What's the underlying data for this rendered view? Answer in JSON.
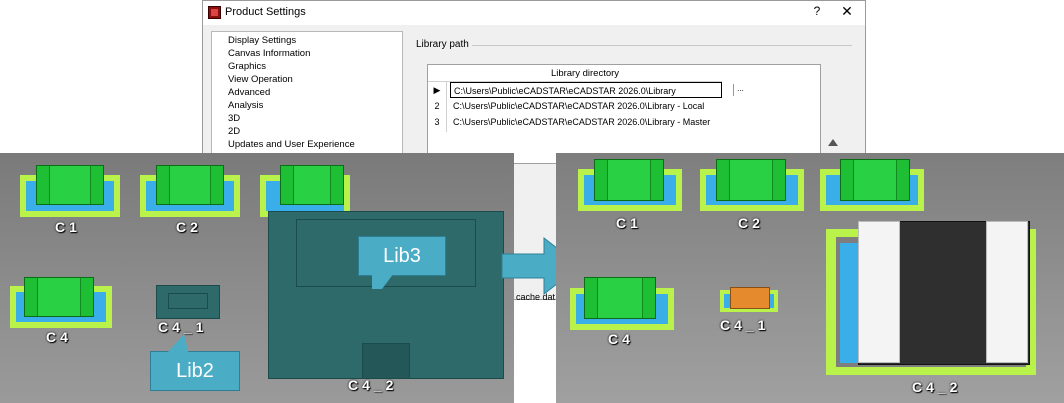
{
  "dialog": {
    "title": "Product Settings",
    "help_label": "?",
    "close_label": "✕",
    "tree": [
      "Display Settings",
      "Canvas Information",
      "Graphics",
      "View Operation",
      "Advanced",
      "Analysis",
      "3D",
      "2D",
      "Updates and User Experience"
    ],
    "group_label": "Library path",
    "grid_header": "Library directory",
    "rows": [
      {
        "num": "",
        "path": "C:\\Users\\Public\\eCADSTAR\\eCADSTAR 2026.0\\Library"
      },
      {
        "num": "2",
        "path": "C:\\Users\\Public\\eCADSTAR\\eCADSTAR 2026.0\\Library - Local"
      },
      {
        "num": "3",
        "path": "C:\\Users\\Public\\eCADSTAR\\eCADSTAR 2026.0\\Library - Master"
      }
    ],
    "browse_label": "...",
    "cache_text": "cache dat"
  },
  "left_view": {
    "labels": [
      "C1",
      "C2",
      "C4",
      "C4_1",
      "C4_2"
    ],
    "callouts": [
      "Lib3",
      "Lib2"
    ]
  },
  "right_view": {
    "labels": [
      "C1",
      "C2",
      "C4",
      "C4_1",
      "C4_2"
    ]
  },
  "colors": {
    "accent": "#4bacc6",
    "footprint": "#b9f24a",
    "pad": "#3aaee8",
    "body": "#1fbf35"
  }
}
